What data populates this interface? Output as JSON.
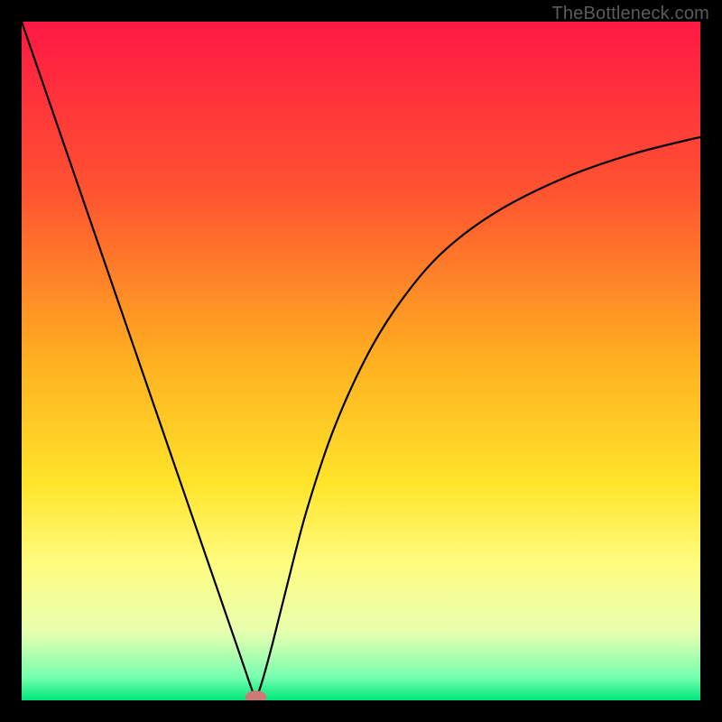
{
  "watermark": "TheBottleneck.com",
  "chart_data": {
    "type": "line",
    "title": "",
    "xlabel": "",
    "ylabel": "",
    "xlim": [
      0,
      1
    ],
    "ylim": [
      0,
      1
    ],
    "grid": false,
    "legend": false,
    "background_gradient": {
      "direction": "vertical",
      "stops": [
        {
          "offset": 0.0,
          "color": "#ff1844"
        },
        {
          "offset": 0.25,
          "color": "#ff5330"
        },
        {
          "offset": 0.5,
          "color": "#ffb020"
        },
        {
          "offset": 0.68,
          "color": "#ffe42a"
        },
        {
          "offset": 0.8,
          "color": "#fffc80"
        },
        {
          "offset": 0.9,
          "color": "#e7ffb0"
        },
        {
          "offset": 0.965,
          "color": "#78ffb0"
        },
        {
          "offset": 1.0,
          "color": "#00e87a"
        }
      ]
    },
    "minimum_marker": {
      "x": 0.345,
      "y": 0.005,
      "color": "#cc7a78"
    },
    "series": [
      {
        "name": "curve",
        "color": "#000000",
        "segment_left": {
          "x": [
            0.0,
            0.05,
            0.1,
            0.15,
            0.2,
            0.25,
            0.28,
            0.3,
            0.32,
            0.335,
            0.345
          ],
          "y": [
            1.0,
            0.855,
            0.71,
            0.565,
            0.42,
            0.275,
            0.188,
            0.13,
            0.072,
            0.028,
            0.0
          ]
        },
        "segment_right": {
          "x": [
            0.345,
            0.355,
            0.37,
            0.39,
            0.42,
            0.46,
            0.51,
            0.56,
            0.62,
            0.7,
            0.8,
            0.9,
            1.0
          ],
          "y": [
            0.0,
            0.03,
            0.085,
            0.165,
            0.28,
            0.4,
            0.51,
            0.59,
            0.66,
            0.72,
            0.77,
            0.805,
            0.83
          ]
        }
      }
    ]
  }
}
